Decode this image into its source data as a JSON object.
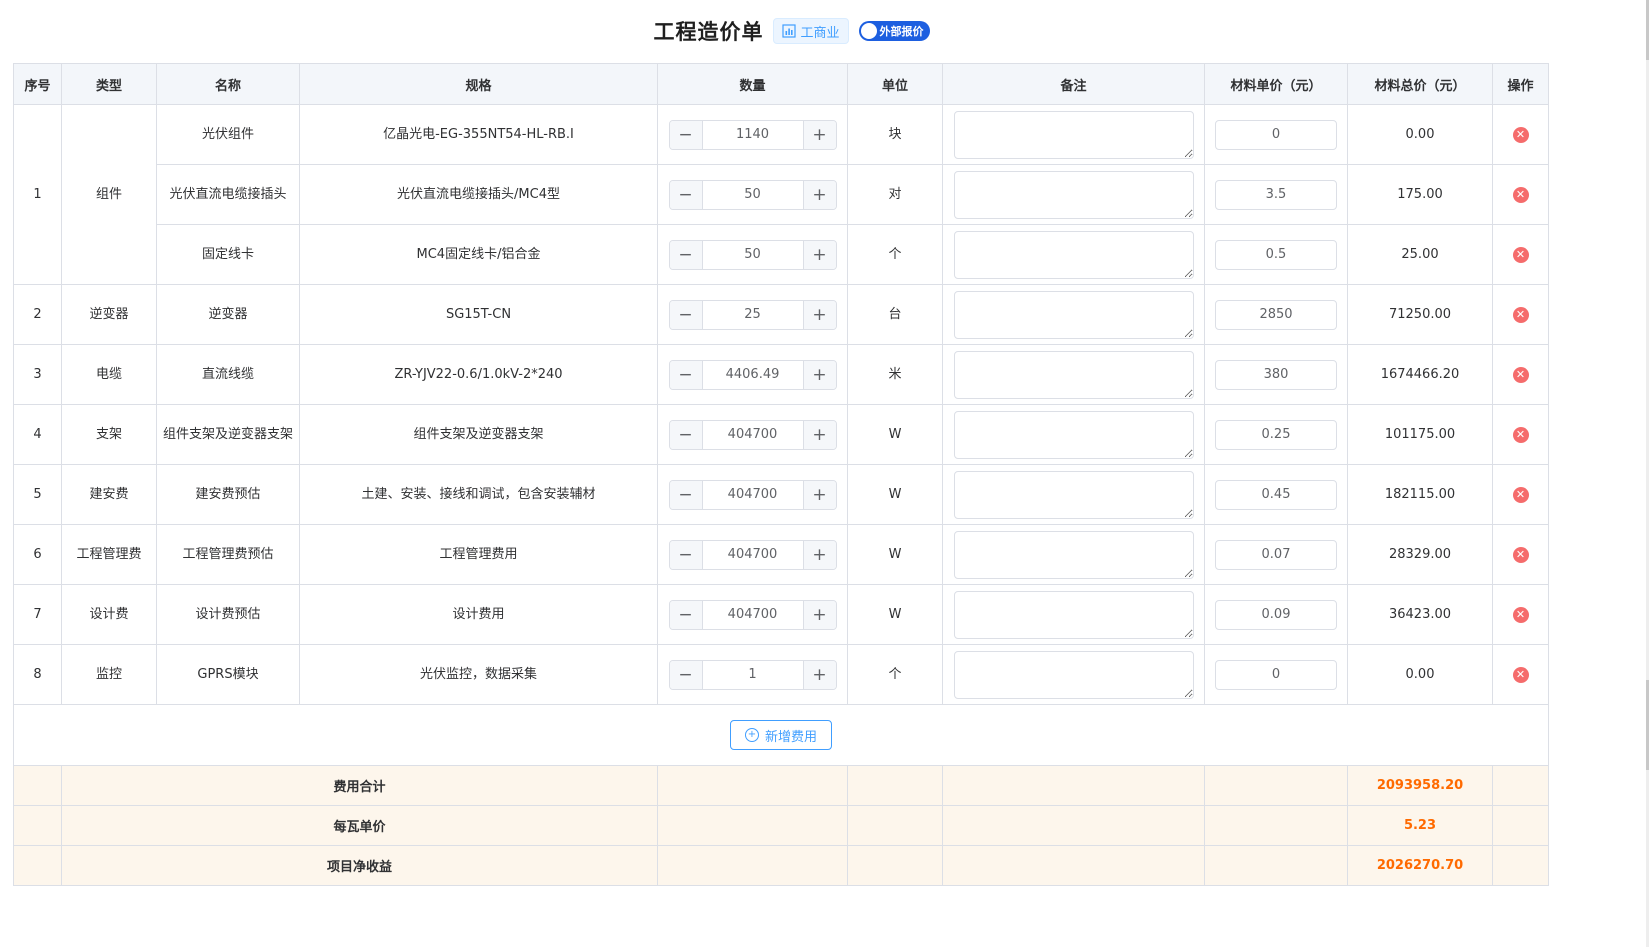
{
  "header": {
    "title": "工程造价单",
    "industry_tag": "工商业",
    "quote_switch": "外部报价"
  },
  "columns": [
    "序号",
    "类型",
    "名称",
    "规格",
    "数量",
    "单位",
    "备注",
    "材料单价（元）",
    "材料总价（元）",
    "操作"
  ],
  "groups": [
    {
      "no": "1",
      "type": "组件",
      "items": [
        {
          "name": "光伏组件",
          "spec": "亿晶光电-EG-355NT54-HL-RB.I",
          "qty": "1140",
          "unit": "块",
          "price": "0",
          "total": "0.00"
        },
        {
          "name": "光伏直流电缆接插头",
          "spec": "光伏直流电缆接插头/MC4型",
          "qty": "50",
          "unit": "对",
          "price": "3.5",
          "total": "175.00"
        },
        {
          "name": "固定线卡",
          "spec": "MC4固定线卡/铝合金",
          "qty": "50",
          "unit": "个",
          "price": "0.5",
          "total": "25.00"
        }
      ]
    },
    {
      "no": "2",
      "type": "逆变器",
      "items": [
        {
          "name": "逆变器",
          "spec": "SG15T-CN",
          "qty": "25",
          "unit": "台",
          "price": "2850",
          "total": "71250.00"
        }
      ]
    },
    {
      "no": "3",
      "type": "电缆",
      "items": [
        {
          "name": "直流线缆",
          "spec": "ZR-YJV22-0.6/1.0kV-2*240",
          "qty": "4406.49",
          "unit": "米",
          "price": "380",
          "total": "1674466.20"
        }
      ]
    },
    {
      "no": "4",
      "type": "支架",
      "items": [
        {
          "name": "组件支架及逆变器支架",
          "spec": "组件支架及逆变器支架",
          "qty": "404700",
          "unit": "W",
          "price": "0.25",
          "total": "101175.00"
        }
      ]
    },
    {
      "no": "5",
      "type": "建安费",
      "items": [
        {
          "name": "建安费预估",
          "spec": "土建、安装、接线和调试，包含安装辅材",
          "qty": "404700",
          "unit": "W",
          "price": "0.45",
          "total": "182115.00"
        }
      ]
    },
    {
      "no": "6",
      "type": "工程管理费",
      "items": [
        {
          "name": "工程管理费预估",
          "spec": "工程管理费用",
          "qty": "404700",
          "unit": "W",
          "price": "0.07",
          "total": "28329.00"
        }
      ]
    },
    {
      "no": "7",
      "type": "设计费",
      "items": [
        {
          "name": "设计费预估",
          "spec": "设计费用",
          "qty": "404700",
          "unit": "W",
          "price": "0.09",
          "total": "36423.00"
        }
      ]
    },
    {
      "no": "8",
      "type": "监控",
      "items": [
        {
          "name": "GPRS模块",
          "spec": "光伏监控，数据采集",
          "qty": "1",
          "unit": "个",
          "price": "0",
          "total": "0.00"
        }
      ]
    }
  ],
  "add_button": "新增费用",
  "summary": [
    {
      "label": "费用合计",
      "value": "2093958.20"
    },
    {
      "label": "每瓦单价",
      "value": "5.23"
    },
    {
      "label": "项目净收益",
      "value": "2026270.70"
    }
  ],
  "icons": {
    "chart": "bar-chart-icon",
    "minus": "minus-icon",
    "plus": "plus-icon",
    "delete": "close-circle-icon",
    "add": "plus-circle-icon"
  },
  "colors": {
    "accent": "#409eff",
    "switch": "#1d5fe0",
    "danger": "#f56c6c",
    "summary_bg": "#fdf6ec",
    "summary_value": "#ff6a00"
  }
}
